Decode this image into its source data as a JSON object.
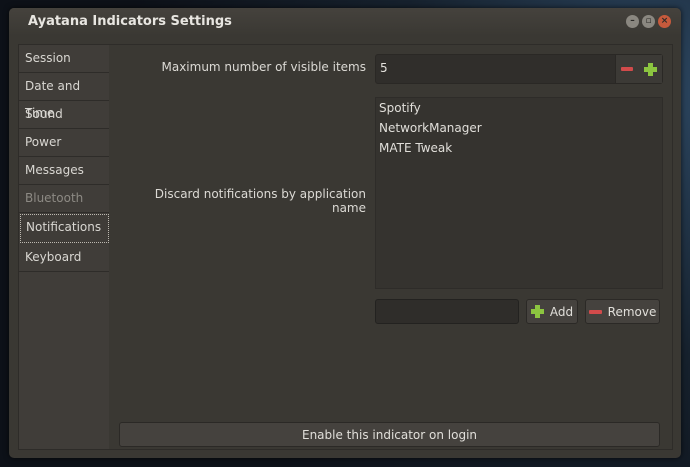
{
  "window": {
    "title": "Ayatana Indicators Settings"
  },
  "sidebar": {
    "items": [
      {
        "label": "Session"
      },
      {
        "label": "Date and Time"
      },
      {
        "label": "Sound"
      },
      {
        "label": "Power"
      },
      {
        "label": "Messages"
      },
      {
        "label": "Bluetooth"
      },
      {
        "label": "Notifications"
      },
      {
        "label": "Keyboard"
      }
    ],
    "active": "Notifications"
  },
  "notifications": {
    "max_visible_label": "Maximum number of visible items",
    "max_visible_value": "5",
    "discard_label": "Discard notifications by application name",
    "apps": [
      "Spotify",
      "NetworkManager",
      "MATE Tweak"
    ],
    "new_app_value": "",
    "add_label": "Add",
    "remove_label": "Remove",
    "enable_label": "Enable this indicator on login"
  },
  "colors": {
    "accent_add": "#8cc540",
    "accent_remove": "#d24b4b",
    "window_bg": "#3a3833"
  }
}
